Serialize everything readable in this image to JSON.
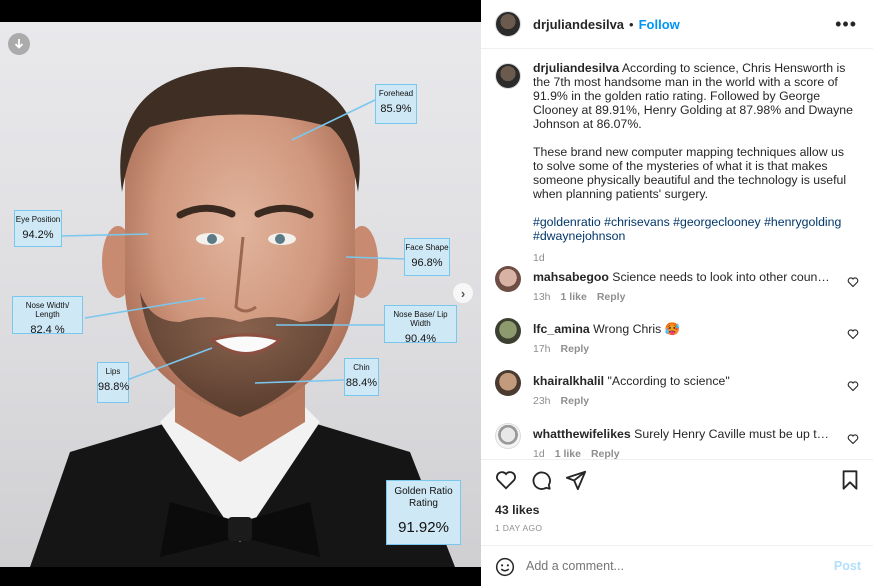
{
  "post": {
    "username": "drjuliandesilva",
    "follow_label": "Follow",
    "separator": "•"
  },
  "image": {
    "labels": [
      {
        "title": "Forehead",
        "value": "85.9%"
      },
      {
        "title": "Eye Position",
        "value": "94.2%"
      },
      {
        "title": "Face Shape",
        "value": "96.8%"
      },
      {
        "title": "Nose Width/ Length",
        "value": "82.4 %"
      },
      {
        "title": "Nose Base/ Lip Width",
        "value": "90.4%"
      },
      {
        "title": "Lips",
        "value": "98.8%"
      },
      {
        "title": "Chin",
        "value": "88.4%"
      }
    ],
    "golden": {
      "title": "Golden Ratio Rating",
      "value": "91.92%"
    }
  },
  "caption": {
    "username": "drjuliandesilva",
    "paragraph1": "According to science, Chris Hensworth is the 7th most handsome man in the world with a score of 91.9% in the golden ratio rating. Followed by George Clooney at 89.91%, Henry Golding at 87.98% and Dwayne Johnson at 86.07%.",
    "paragraph2": "These brand new computer mapping techniques allow us to solve some of the mysteries of what it is that makes someone physically beautiful and the technology is useful when planning patients' surgery.",
    "hashtags": "#goldenratio #chrisevans #georgeclooney #henrygolding #dwaynejohnson",
    "age": "1d"
  },
  "comments": [
    {
      "username": "mahsabegoo",
      "text": "Science needs to look into other countries ...",
      "age": "13h",
      "likes": "1 like",
      "reply": "Reply"
    },
    {
      "username": "lfc_amina",
      "text": "Wrong Chris 🥵",
      "age": "17h",
      "likes": "",
      "reply": "Reply"
    },
    {
      "username": "khairalkhalil",
      "text": "\"According to science\"",
      "age": "23h",
      "likes": "",
      "reply": "Reply"
    },
    {
      "username": "whatthewifelikes",
      "text": "Surely Henry Caville must be up there",
      "age": "1d",
      "likes": "1 like",
      "reply": "Reply"
    }
  ],
  "stats": {
    "likes": "43 likes",
    "date": "1 DAY AGO"
  },
  "composer": {
    "placeholder": "Add a comment...",
    "post_label": "Post"
  },
  "icons": [
    "download-icon",
    "chevron-right-icon",
    "more-icon",
    "heart-icon",
    "comment-icon",
    "share-icon",
    "bookmark-icon",
    "emoji-icon"
  ]
}
